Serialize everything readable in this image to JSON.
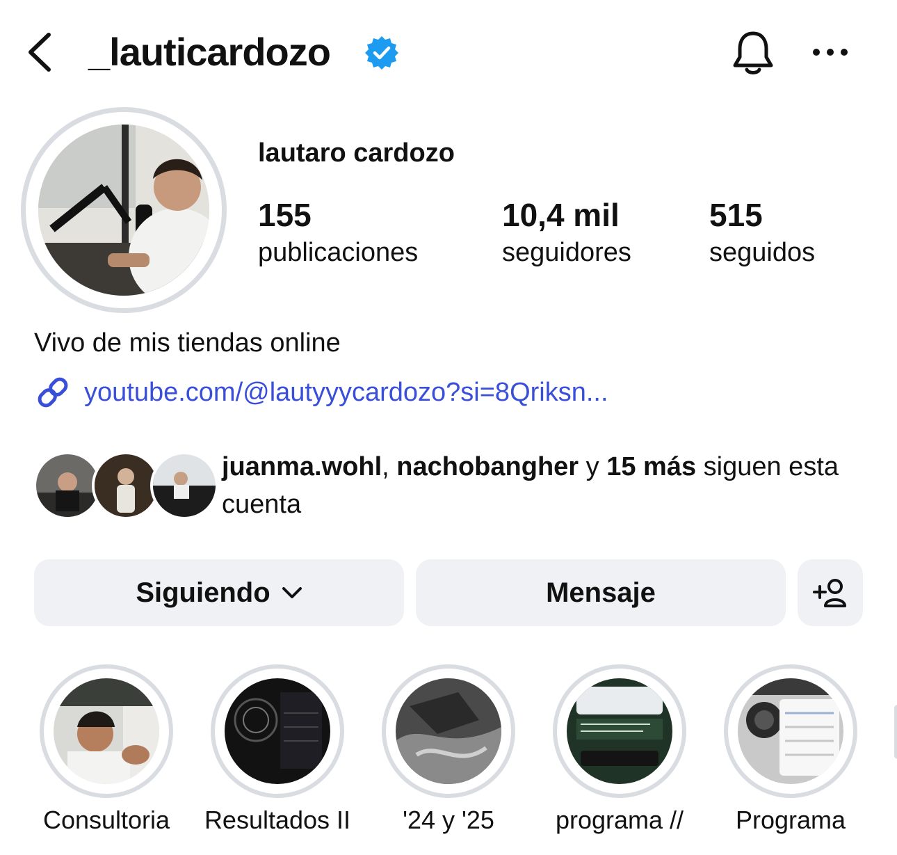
{
  "header": {
    "username": "_lauticardozo",
    "back_icon": "chevron-left-icon",
    "verified_icon": "verified-badge-icon",
    "bell_icon": "bell-icon",
    "more_icon": "more-horizontal-icon",
    "verified_color": "#1d9bf0"
  },
  "profile": {
    "full_name": "lautaro cardozo",
    "stats": [
      {
        "value": "155",
        "label": "publicaciones"
      },
      {
        "value": "10,4 mil",
        "label": "seguidores"
      },
      {
        "value": "515",
        "label": "seguidos"
      }
    ],
    "bio": "Vivo de mis tiendas online",
    "link": "youtube.com/@lautyyycardozo?si=8Qriksn...",
    "link_color": "#3a4fd9"
  },
  "mutual": {
    "user1": "juanma.wohl",
    "sep1": ", ",
    "user2": "nachobangher",
    "sep2": " y ",
    "more": "15 más",
    "suffix": " siguen esta cuenta"
  },
  "actions": {
    "following_label": "Siguiendo",
    "message_label": "Mensaje",
    "add_person_icon": "add-person-icon"
  },
  "highlights": [
    {
      "label": "Consultoria"
    },
    {
      "label": "Resultados II"
    },
    {
      "label": "'24 y '25"
    },
    {
      "label": "programa //"
    },
    {
      "label": "Programa"
    }
  ]
}
